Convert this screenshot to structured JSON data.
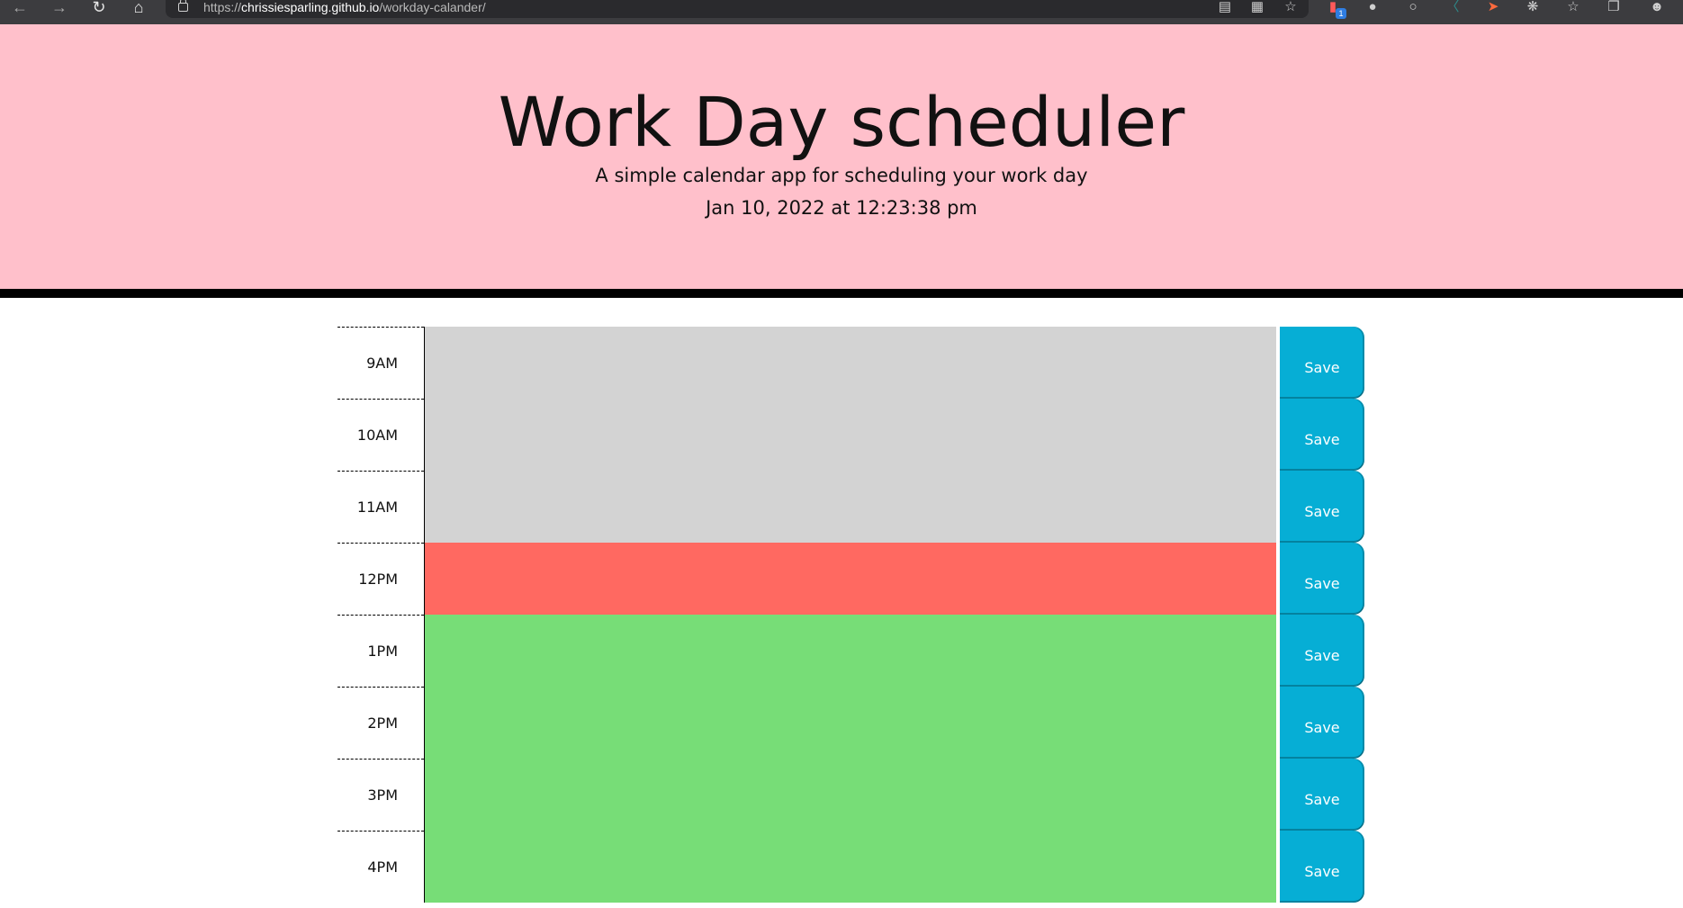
{
  "browser": {
    "url_scheme": "https://",
    "url_host": "chrissiesparling.github.io",
    "url_path": "/workday-calander/",
    "extension_badge": "1"
  },
  "header": {
    "title": "Work Day scheduler",
    "subtitle": "A simple calendar app for scheduling your work day",
    "current_day": "Jan 10, 2022 at 12:23:38 pm"
  },
  "colors": {
    "header_bg": "#ffc0cb",
    "past": "#d3d3d3",
    "present": "#ff6961",
    "future": "#77dd77",
    "save_button": "#06aed5"
  },
  "schedule": {
    "rows": [
      {
        "hour": "9AM",
        "state": "past",
        "text": "",
        "save_label": "Save"
      },
      {
        "hour": "10AM",
        "state": "past",
        "text": "",
        "save_label": "Save"
      },
      {
        "hour": "11AM",
        "state": "past",
        "text": "",
        "save_label": "Save"
      },
      {
        "hour": "12PM",
        "state": "present",
        "text": "",
        "save_label": "Save"
      },
      {
        "hour": "1PM",
        "state": "future",
        "text": "",
        "save_label": "Save"
      },
      {
        "hour": "2PM",
        "state": "future",
        "text": "",
        "save_label": "Save"
      },
      {
        "hour": "3PM",
        "state": "future",
        "text": "",
        "save_label": "Save"
      },
      {
        "hour": "4PM",
        "state": "future",
        "text": "",
        "save_label": "Save"
      }
    ]
  }
}
